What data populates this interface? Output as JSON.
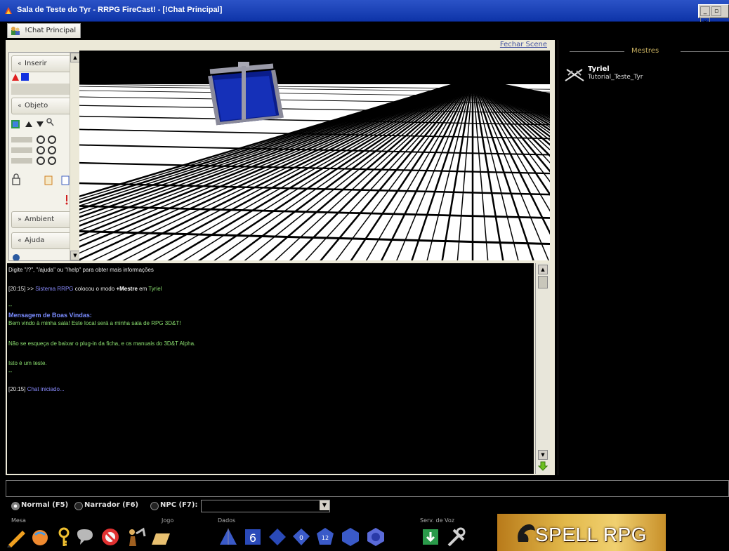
{
  "window": {
    "title": "Sala de Teste do Tyr - RRPG FireCast! - [!Chat Principal]",
    "controls": [
      "_",
      "▫",
      "x"
    ]
  },
  "tabs": [
    {
      "label": "!Chat Principal"
    }
  ],
  "scene": {
    "close_label": "Fechar Scene"
  },
  "sidebar": {
    "sections": [
      {
        "label": "Inserir",
        "chev": "«"
      },
      {
        "label": "Objeto",
        "chev": "«"
      },
      {
        "label": "Ambient",
        "chev": "»"
      },
      {
        "label": "Ajuda",
        "chev": "«"
      }
    ]
  },
  "chat": {
    "lines": [
      {
        "text": "Digite \"/?\", \"/ajuda\" ou \"/help\" para obter mais informações",
        "color": "#e8e8e8"
      },
      {
        "time": "[20:15] >>",
        "pre": "Sistema RRPG",
        "mid": " colocou o modo ",
        "bold": "+Mestre",
        "post": " em ",
        "name": "Tyriel"
      },
      {
        "text": "--",
        "color": "#7fd66b"
      },
      {
        "text": "Mensagem de Boas Vindas:",
        "color": "#7a8cff",
        "bold": true
      },
      {
        "text": "Bem vindo à minha sala! Este local será a minha sala de RPG 3D&T!",
        "color": "#8be070"
      },
      {
        "text": "Não se esqueça de baixar o plug-in da ficha, e os manuais do 3D&T Alpha.",
        "color": "#8be070"
      },
      {
        "text": "Isto é um teste.",
        "color": "#8be070"
      },
      {
        "text": "--",
        "color": "#7fd66b"
      },
      {
        "time": "[20:15]",
        "text": "Chat iniciado...",
        "color": "#8a8cff"
      }
    ]
  },
  "masters": {
    "header": "Mestres",
    "items": [
      {
        "name": "Tyriel",
        "login": "Tutorial_Teste_Tyr"
      }
    ]
  },
  "modes": [
    {
      "label": "Normal (F5)",
      "selected": true
    },
    {
      "label": "Narrador (F6)",
      "selected": false
    },
    {
      "label": "NPC (F7):",
      "selected": false
    }
  ],
  "toolbar": {
    "groups": [
      {
        "label": "Mesa"
      },
      {
        "label": "Jogo"
      },
      {
        "label": "Dados"
      },
      {
        "label": "Serv. de Voz"
      }
    ],
    "dice": {
      "d6": "6",
      "d10": "0",
      "d12": "12"
    }
  },
  "banner": {
    "text": "SPELL RPG"
  },
  "colors": {
    "accent_blue": "#0e34a8",
    "chat_green": "#8be070",
    "chat_blue": "#7a8cff"
  }
}
